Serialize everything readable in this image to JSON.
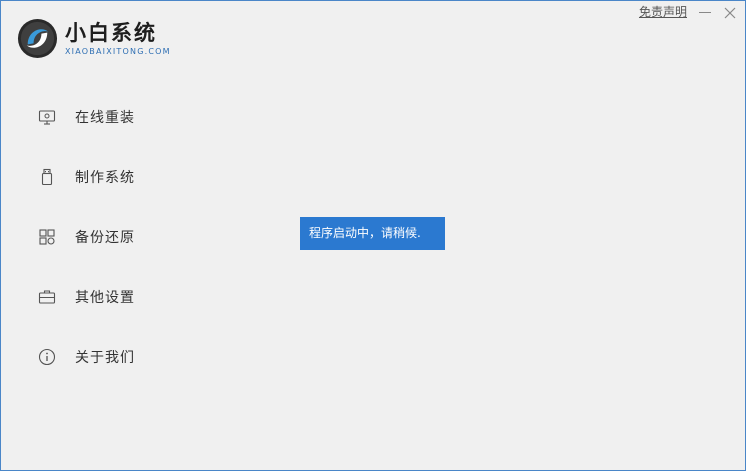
{
  "app": {
    "name": "小白系统",
    "subtitle": "XIAOBAIXITONG.COM"
  },
  "topbar": {
    "disclaimer_label": "免责声明",
    "minimize_icon": "minimize-icon",
    "close_icon": "close-icon"
  },
  "sidebar": {
    "items": [
      {
        "label": "在线重装",
        "icon": "monitor-icon"
      },
      {
        "label": "制作系统",
        "icon": "usb-drive-icon"
      },
      {
        "label": "备份还原",
        "icon": "backup-grid-icon"
      },
      {
        "label": "其他设置",
        "icon": "briefcase-icon"
      },
      {
        "label": "关于我们",
        "icon": "info-icon"
      }
    ]
  },
  "toast": {
    "message": "程序启动中，请稍候."
  },
  "colors": {
    "accent": "#2b79d0",
    "window_border": "#4a86c8",
    "background": "#f0f0f0"
  }
}
